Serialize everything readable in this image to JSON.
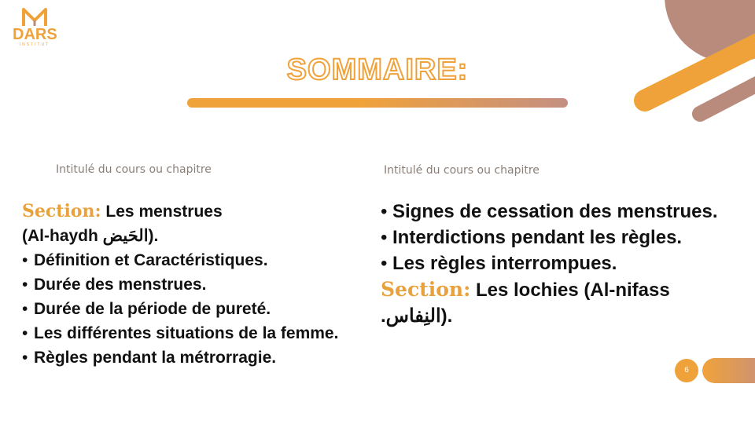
{
  "logo": {
    "text": "DARS",
    "sub": "INSTITUT"
  },
  "title": "SOMMAIRE:",
  "left": {
    "caption": "Intitulé du cours ou chapitre",
    "section_keyword": "Section:",
    "section_title": " Les menstrues",
    "section_title_2": "(Al-haydh الحَيض).",
    "items": [
      "Définition et Caractéristiques.",
      "Durée des menstrues.",
      "Durée de la période de pureté.",
      "Les différentes situations de la femme.",
      "Règles pendant la métrorragie."
    ]
  },
  "right": {
    "caption": "Intitulé du cours ou chapitre",
    "items": [
      "Signes de cessation des menstrues.",
      "Interdictions pendant les règles.",
      "Les règles interrompues."
    ],
    "section_keyword": "Section:",
    "section_title": " Les lochies (Al-nifass",
    "section_title_2": ".النِفاس)."
  },
  "page_number": "6",
  "bullet": "•",
  "colors": {
    "accent": "#f0a23a",
    "mauve": "#c48f82",
    "brown": "#b98b7c"
  }
}
